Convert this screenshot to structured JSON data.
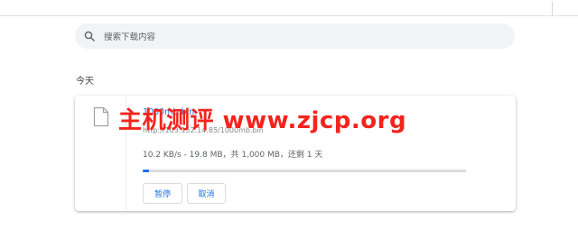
{
  "search": {
    "placeholder": "搜索下载内容",
    "icon": "search-icon"
  },
  "section": {
    "date_label": "今天"
  },
  "download": {
    "file_name": "1000mb.bin",
    "url": "http://103.152.14.85/1000mb.bin",
    "status": "10.2 KB/s - 19.8 MB，共 1,000 MB，还剩 1 天",
    "progress_fraction": 0.0198,
    "file_icon": "file-icon",
    "pause_label": "暂停",
    "cancel_label": "取消"
  },
  "watermark": {
    "text": "主机测评 www.zjcp.org"
  },
  "colors": {
    "accent": "#1a73e8",
    "watermark": "#f2241d",
    "search_bg": "#f1f3f4"
  }
}
